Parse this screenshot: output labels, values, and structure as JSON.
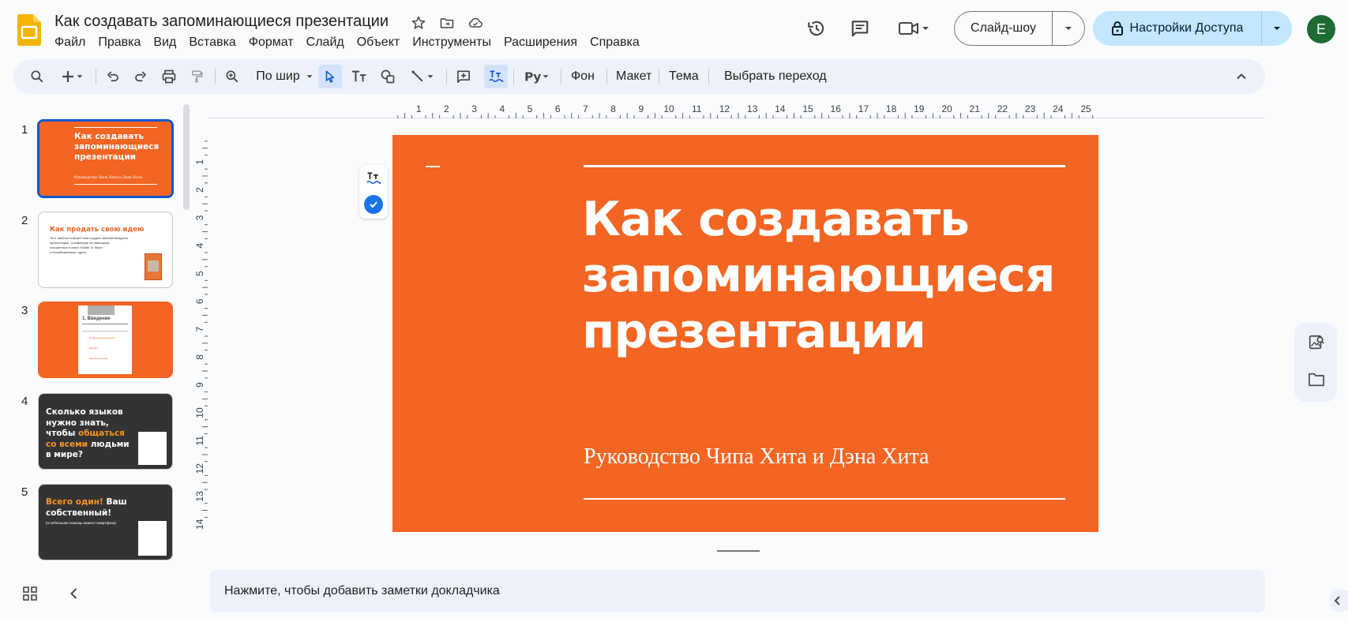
{
  "app": {
    "doc_title": "Как создавать запоминающиеся презентации",
    "icons": [
      "star-icon",
      "move-to-folder-icon",
      "cloud-saved-icon"
    ]
  },
  "menu": [
    "Файл",
    "Правка",
    "Вид",
    "Вставка",
    "Формат",
    "Слайд",
    "Объект",
    "Инструменты",
    "Расширения",
    "Справка"
  ],
  "header": {
    "slideshow_label": "Слайд-шоу",
    "share_label": "Настройки Доступа",
    "avatar_letter": "E"
  },
  "toolbar": {
    "zoom_label": "По шир",
    "background_label": "Фон",
    "layout_label": "Макет",
    "theme_label": "Тема",
    "transition_label": "Выбрать переход"
  },
  "filmstrip": {
    "slides": [
      {
        "num": "1",
        "title": "Как создавать запоминающиеся презентации",
        "subtitle": "Руководство Чипа Хита и Дэна Хита"
      },
      {
        "num": "2",
        "title": "Как продать свою идею",
        "body": "Этот шаблон поможет вам создать запоминающуюся презентацию, основанную на принципах, изложенных в книге «Made To Stick» («Незабываемые» идеи)"
      },
      {
        "num": "3",
        "title": "1. Введение",
        "items": [
          "Непредсказуемый факт",
          "Эмоции",
          "Простые истории"
        ]
      },
      {
        "num": "4",
        "title_white": "Сколько языков нужно знать, чтобы",
        "title_orange": "общаться со всеми",
        "title_white2": "людьми в мире?"
      },
      {
        "num": "5",
        "title_orange": "Всего один!",
        "title_white": " Ваш собственный!",
        "subtitle": "(и небольшая помощь вашего смартфона)"
      }
    ]
  },
  "slide": {
    "title": "Как создавать запоминающиеся презентации",
    "subtitle": "Руководство Чипа Хита и Дэна Хита"
  },
  "ruler": {
    "h_labels": [
      "1",
      "2",
      "3",
      "4",
      "5",
      "6",
      "7",
      "8",
      "9",
      "10",
      "11",
      "12",
      "13",
      "14",
      "15",
      "16",
      "17",
      "18",
      "19",
      "20",
      "21",
      "22",
      "23",
      "24",
      "25"
    ],
    "v_labels": [
      "1",
      "2",
      "3",
      "4",
      "5",
      "6",
      "7",
      "8",
      "9",
      "10",
      "11",
      "12",
      "13",
      "14"
    ]
  },
  "notes": {
    "placeholder": "Нажмите, чтобы добавить заметки докладчика"
  },
  "colors": {
    "accent_orange": "#f26522",
    "dark_slide": "#333333",
    "share_bg": "#c2e7ff",
    "avatar_bg": "#1e6b33"
  }
}
